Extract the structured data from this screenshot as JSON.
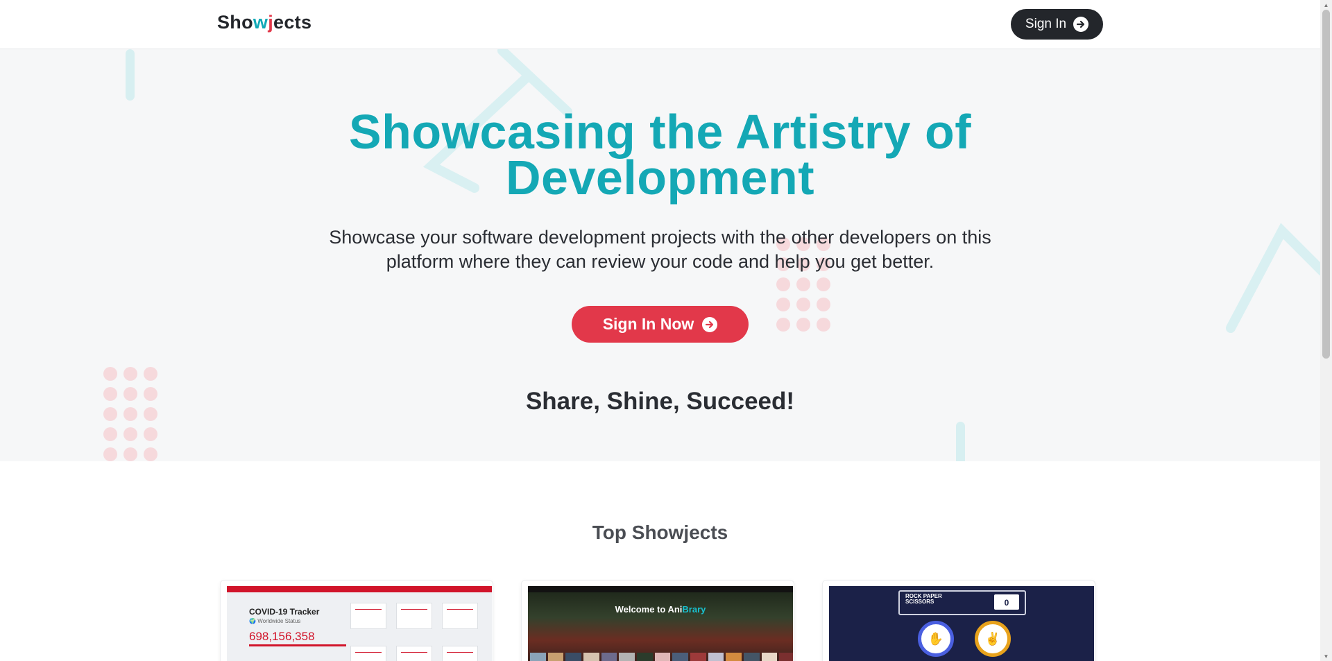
{
  "nav": {
    "logo_parts": [
      "Sho",
      "w",
      "j",
      "ects"
    ],
    "signin_label": "Sign In"
  },
  "hero": {
    "title_line1": "Showcasing the Artistry of",
    "title_line2": "Development",
    "subtitle_line1": "Showcase your software development projects with the other developers on this",
    "subtitle_line2": "platform where they can review your code and help you get better.",
    "cta_label": "Sign In Now",
    "tagline": "Share, Shine, Succeed!"
  },
  "top": {
    "title": "Top Showjects",
    "cards": [
      {
        "thumb_title": "COVID-19 Tracker",
        "thumb_sub": "Worldwide Status",
        "thumb_value": "698,156,358"
      },
      {
        "thumb_title": "Welcome to Ani",
        "thumb_title_accent": "Brary"
      },
      {
        "thumb_title": "ROCK PAPER SCISSORS",
        "thumb_score": "0"
      }
    ]
  },
  "colors": {
    "accent_teal": "#14a8b5",
    "accent_red": "#e2384a",
    "dark": "#23262b"
  },
  "icons": [
    "arrow-right-circle-icon"
  ]
}
